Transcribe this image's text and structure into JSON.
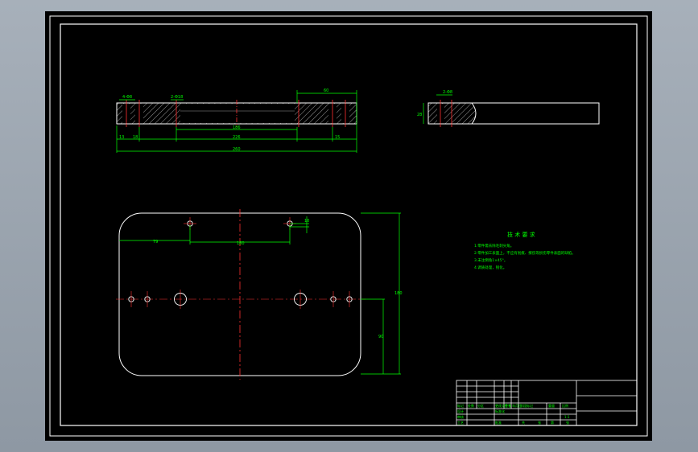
{
  "colors": {
    "background": "#000000",
    "frame": "#ffffff",
    "dimension": "#00ff00",
    "centerline": "#ff0000",
    "hatch": "#ffffff"
  },
  "front_view": {
    "dims": {
      "d_top_left": "4-Φ8",
      "d_top_mid": "2-Φ18",
      "d_top_right": "60",
      "d_inner": "186",
      "d_mid": "226",
      "d_bot_l1": "13",
      "d_bot_l2": "18",
      "d_bot_r": "15",
      "d_total": "260"
    }
  },
  "side_view": {
    "dims": {
      "d_top": "2-Φ8",
      "d_left": "28"
    }
  },
  "plan_view": {
    "dims": {
      "d_left": "79",
      "d_center": "160",
      "d_small": "10",
      "d_height": "180",
      "d_half": "90"
    }
  },
  "tech_notes": {
    "title": "技 术 要 求",
    "lines": [
      "1.零件需去除毛刺尖角。",
      "2.零件加工表面上，不应有划痕、擦伤等损伤零件表面的缺陷。",
      "3.未注倒角1×45°。",
      "4.调质处理，锐化。"
    ]
  },
  "title_block": {
    "cells": [
      "标记",
      "处数",
      "分区",
      "更改文件号",
      "签名",
      "年月日",
      "设计",
      "标准化",
      "审核",
      "工艺",
      "批准",
      "阶段标记",
      "重量",
      "比例",
      "共",
      "张",
      "第",
      "张",
      "1:1"
    ]
  }
}
